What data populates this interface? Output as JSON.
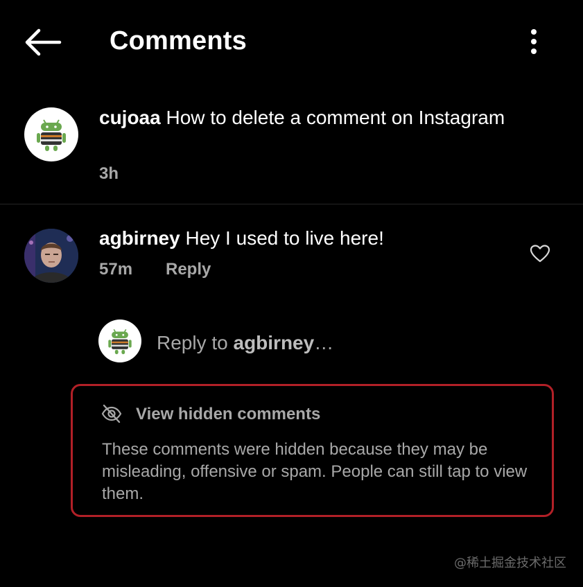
{
  "header": {
    "title": "Comments",
    "back_icon": "arrow-left-icon",
    "more_icon": "vertical-ellipsis-icon"
  },
  "caption": {
    "username": "cujoaa",
    "text": "How to delete a comment on Instagram",
    "time": "3h"
  },
  "comment": {
    "username": "agbirney",
    "text": "Hey I used to live here!",
    "time": "57m",
    "reply_label": "Reply",
    "like_icon": "heart-outline-icon"
  },
  "reply_box": {
    "prefix": "Reply to",
    "target": "agbirney",
    "suffix": "…"
  },
  "hidden_comments": {
    "toggle_label": "View hidden comments",
    "icon": "eye-off-icon",
    "description": "These comments were hidden because they may be misleading, offensive or spam. People can still tap to view them."
  },
  "watermark": "@稀土掘金技术社区",
  "colors": {
    "background": "#000000",
    "text_primary": "#ffffff",
    "text_secondary": "#a8a8a8",
    "highlight_border": "#b22027",
    "divider": "#262626"
  }
}
